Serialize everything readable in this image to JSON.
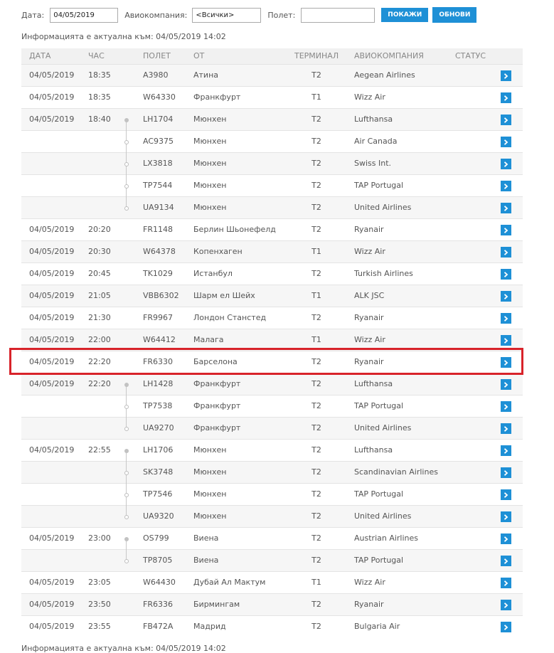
{
  "filters": {
    "date_label": "Дата:",
    "date_value": "04/05/2019",
    "airline_label": "Авиокомпания:",
    "airline_value": "<Всички>",
    "flight_label": "Полет:",
    "flight_value": "",
    "show_button": "ПОКАЖИ",
    "refresh_button": "ОБНОВИ"
  },
  "info_text": "Информацията е актуална към: 04/05/2019 14:02",
  "columns": {
    "date": "ДАТА",
    "time": "ЧАС",
    "flight": "ПОЛЕТ",
    "from": "ОТ",
    "terminal": "ТЕРМИНАЛ",
    "airline": "АВИОКОМПАНИЯ",
    "status": "СТАТУС"
  },
  "colors": {
    "accent": "#1e90d6",
    "highlight_border": "#d8232a"
  },
  "row_icon": "chevron-right-icon",
  "rows": [
    {
      "date": "04/05/2019",
      "time": "18:35",
      "flight": "A3980",
      "from": "Атина",
      "terminal": "T2",
      "airline": "Aegean Airlines"
    },
    {
      "date": "04/05/2019",
      "time": "18:35",
      "flight": "W64330",
      "from": "Франкфурт",
      "terminal": "T1",
      "airline": "Wizz Air"
    },
    {
      "date": "04/05/2019",
      "time": "18:40",
      "flight": "LH1704",
      "from": "Мюнхен",
      "terminal": "T2",
      "airline": "Lufthansa",
      "codeshare": "start"
    },
    {
      "date": "",
      "time": "",
      "flight": "AC9375",
      "from": "Мюнхен",
      "terminal": "T2",
      "airline": "Air Canada",
      "codeshare": "mid"
    },
    {
      "date": "",
      "time": "",
      "flight": "LX3818",
      "from": "Мюнхен",
      "terminal": "T2",
      "airline": "Swiss Int.",
      "codeshare": "mid"
    },
    {
      "date": "",
      "time": "",
      "flight": "TP7544",
      "from": "Мюнхен",
      "terminal": "T2",
      "airline": "TAP Portugal",
      "codeshare": "mid"
    },
    {
      "date": "",
      "time": "",
      "flight": "UA9134",
      "from": "Мюнхен",
      "terminal": "T2",
      "airline": "United Airlines",
      "codeshare": "end"
    },
    {
      "date": "04/05/2019",
      "time": "20:20",
      "flight": "FR1148",
      "from": "Берлин Шьонефелд",
      "terminal": "T2",
      "airline": "Ryanair"
    },
    {
      "date": "04/05/2019",
      "time": "20:30",
      "flight": "W64378",
      "from": "Копенхаген",
      "terminal": "T1",
      "airline": "Wizz Air"
    },
    {
      "date": "04/05/2019",
      "time": "20:45",
      "flight": "TK1029",
      "from": "Истанбул",
      "terminal": "T2",
      "airline": "Turkish Airlines"
    },
    {
      "date": "04/05/2019",
      "time": "21:05",
      "flight": "VBB6302",
      "from": "Шарм ел Шейх",
      "terminal": "T1",
      "airline": "ALK JSC"
    },
    {
      "date": "04/05/2019",
      "time": "21:30",
      "flight": "FR9967",
      "from": "Лондон Станстед",
      "terminal": "T2",
      "airline": "Ryanair"
    },
    {
      "date": "04/05/2019",
      "time": "22:00",
      "flight": "W64412",
      "from": "Малага",
      "terminal": "T1",
      "airline": "Wizz Air"
    },
    {
      "date": "04/05/2019",
      "time": "22:20",
      "flight": "FR6330",
      "from": "Барселона",
      "terminal": "T2",
      "airline": "Ryanair",
      "highlighted": true
    },
    {
      "date": "04/05/2019",
      "time": "22:20",
      "flight": "LH1428",
      "from": "Франкфурт",
      "terminal": "T2",
      "airline": "Lufthansa",
      "codeshare": "start"
    },
    {
      "date": "",
      "time": "",
      "flight": "TP7538",
      "from": "Франкфурт",
      "terminal": "T2",
      "airline": "TAP Portugal",
      "codeshare": "mid"
    },
    {
      "date": "",
      "time": "",
      "flight": "UA9270",
      "from": "Франкфурт",
      "terminal": "T2",
      "airline": "United Airlines",
      "codeshare": "end"
    },
    {
      "date": "04/05/2019",
      "time": "22:55",
      "flight": "LH1706",
      "from": "Мюнхен",
      "terminal": "T2",
      "airline": "Lufthansa",
      "codeshare": "start"
    },
    {
      "date": "",
      "time": "",
      "flight": "SK3748",
      "from": "Мюнхен",
      "terminal": "T2",
      "airline": "Scandinavian Airlines",
      "codeshare": "mid"
    },
    {
      "date": "",
      "time": "",
      "flight": "TP7546",
      "from": "Мюнхен",
      "terminal": "T2",
      "airline": "TAP Portugal",
      "codeshare": "mid"
    },
    {
      "date": "",
      "time": "",
      "flight": "UA9320",
      "from": "Мюнхен",
      "terminal": "T2",
      "airline": "United Airlines",
      "codeshare": "end"
    },
    {
      "date": "04/05/2019",
      "time": "23:00",
      "flight": "OS799",
      "from": "Виена",
      "terminal": "T2",
      "airline": "Austrian Airlines",
      "codeshare": "start"
    },
    {
      "date": "",
      "time": "",
      "flight": "TP8705",
      "from": "Виена",
      "terminal": "T2",
      "airline": "TAP Portugal",
      "codeshare": "end"
    },
    {
      "date": "04/05/2019",
      "time": "23:05",
      "flight": "W64430",
      "from": "Дубай Ал Мактум",
      "terminal": "T1",
      "airline": "Wizz Air"
    },
    {
      "date": "04/05/2019",
      "time": "23:50",
      "flight": "FR6336",
      "from": "Бирмингам",
      "terminal": "T2",
      "airline": "Ryanair"
    },
    {
      "date": "04/05/2019",
      "time": "23:55",
      "flight": "FB472A",
      "from": "Мадрид",
      "terminal": "T2",
      "airline": "Bulgaria Air"
    }
  ]
}
